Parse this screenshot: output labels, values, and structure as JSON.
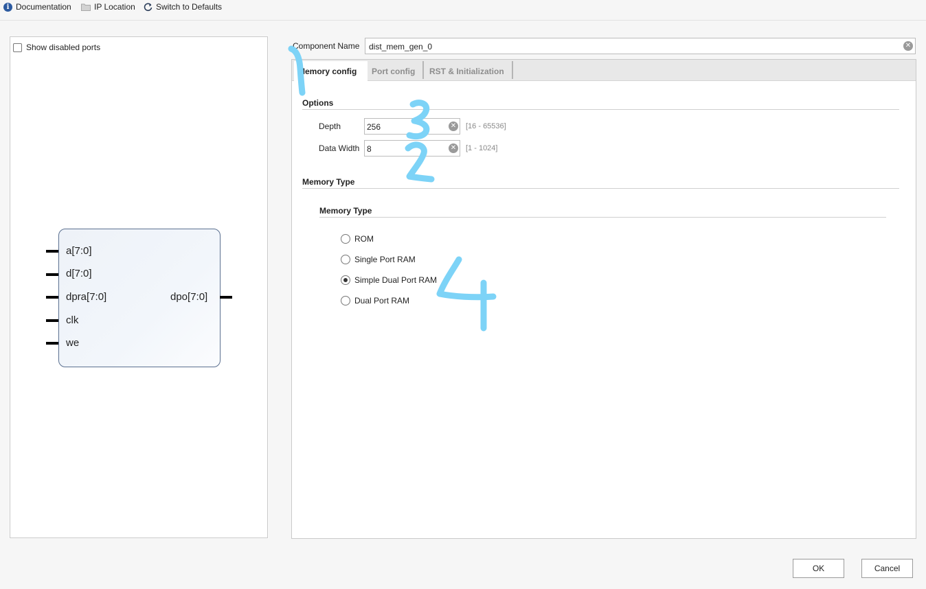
{
  "toolbar": {
    "documentation": "Documentation",
    "ip_location": "IP Location",
    "switch_defaults": "Switch to Defaults"
  },
  "left_panel": {
    "show_disabled_ports": "Show disabled ports",
    "block": {
      "inputs": [
        "a[7:0]",
        "d[7:0]",
        "dpra[7:0]",
        "clk",
        "we"
      ],
      "output": "dpo[7:0]"
    }
  },
  "component": {
    "label": "Component Name",
    "value": "dist_mem_gen_0"
  },
  "tabs": [
    {
      "label": "Memory config",
      "active": true
    },
    {
      "label": "Port config",
      "active": false
    },
    {
      "label": "RST & Initialization",
      "active": false
    }
  ],
  "options": {
    "title": "Options",
    "depth_label": "Depth",
    "depth_value": "256",
    "depth_range": "[16 - 65536]",
    "width_label": "Data Width",
    "width_value": "8",
    "width_range": "[1 - 1024]"
  },
  "memory_type": {
    "section_title": "Memory Type",
    "group_title": "Memory Type",
    "options": [
      {
        "label": "ROM",
        "selected": false
      },
      {
        "label": "Single Port RAM",
        "selected": false
      },
      {
        "label": "Simple Dual Port RAM",
        "selected": true
      },
      {
        "label": "Dual Port RAM",
        "selected": false
      }
    ]
  },
  "buttons": {
    "ok": "OK",
    "cancel": "Cancel"
  },
  "annotations": {
    "color": "#7dd3f7",
    "marks": [
      "1",
      "3",
      "2",
      "4"
    ]
  }
}
